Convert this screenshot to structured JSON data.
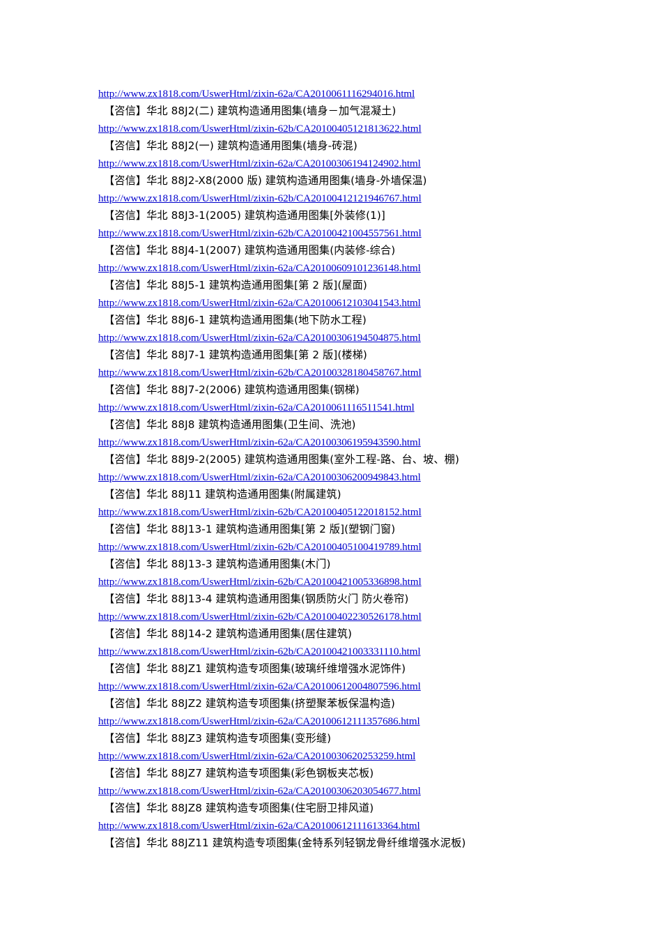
{
  "document": {
    "page_background": "#ffffff",
    "link_color": "#0000cc",
    "text_color": "#000000"
  },
  "entries": [
    {
      "url": "http://www.zx1818.com/UswerHtml/zixin-62a/CA2010061116294016.html",
      "title": "【咨信】华北 88J2(二) 建筑构造通用图集(墙身－加气混凝土)"
    },
    {
      "url": "http://www.zx1818.com/UswerHtml/zixin-62b/CA20100405121813622.html",
      "title": "【咨信】华北 88J2(一) 建筑构造通用图集(墙身-砖混)"
    },
    {
      "url": "http://www.zx1818.com/UswerHtml/zixin-62a/CA20100306194124902.html",
      "title": "【咨信】华北 88J2-X8(2000 版) 建筑构造通用图集(墙身-外墙保温)"
    },
    {
      "url": "http://www.zx1818.com/UswerHtml/zixin-62b/CA20100412121946767.html",
      "title": "【咨信】华北 88J3-1(2005) 建筑构造通用图集[外装修(1)]"
    },
    {
      "url": "http://www.zx1818.com/UswerHtml/zixin-62b/CA20100421004557561.html",
      "title": "【咨信】华北 88J4-1(2007) 建筑构造通用图集(内装修-综合)"
    },
    {
      "url": "http://www.zx1818.com/UswerHtml/zixin-62a/CA20100609101236148.html",
      "title": "【咨信】华北 88J5-1 建筑构造通用图集[第 2 版](屋面)"
    },
    {
      "url": "http://www.zx1818.com/UswerHtml/zixin-62a/CA20100612103041543.html",
      "title": "【咨信】华北 88J6-1 建筑构造通用图集(地下防水工程)"
    },
    {
      "url": "http://www.zx1818.com/UswerHtml/zixin-62a/CA20100306194504875.html",
      "title": "【咨信】华北 88J7-1 建筑构造通用图集[第 2 版](楼梯)"
    },
    {
      "url": "http://www.zx1818.com/UswerHtml/zixin-62b/CA20100328180458767.html",
      "title": "【咨信】华北 88J7-2(2006) 建筑构造通用图集(钢梯)"
    },
    {
      "url": "http://www.zx1818.com/UswerHtml/zixin-62a/CA2010061116511541.html",
      "title": "【咨信】华北 88J8 建筑构造通用图集(卫生间、洗池)"
    },
    {
      "url": "http://www.zx1818.com/UswerHtml/zixin-62a/CA20100306195943590.html",
      "title": "【咨信】华北 88J9-2(2005) 建筑构造通用图集(室外工程-路、台、坡、棚)"
    },
    {
      "url": "http://www.zx1818.com/UswerHtml/zixin-62a/CA20100306200949843.html",
      "title": "【咨信】华北 88J11 建筑构造通用图集(附属建筑)"
    },
    {
      "url": "http://www.zx1818.com/UswerHtml/zixin-62b/CA20100405122018152.html",
      "title": "【咨信】华北 88J13-1 建筑构造通用图集[第 2 版](塑钢门窗)"
    },
    {
      "url": "http://www.zx1818.com/UswerHtml/zixin-62b/CA20100405100419789.html",
      "title": "【咨信】华北 88J13-3 建筑构造通用图集(木门)"
    },
    {
      "url": "http://www.zx1818.com/UswerHtml/zixin-62b/CA20100421005336898.html",
      "title": "【咨信】华北 88J13-4 建筑构造通用图集(钢质防火门 防火卷帘)"
    },
    {
      "url": "http://www.zx1818.com/UswerHtml/zixin-62b/CA20100402230526178.html",
      "title": "【咨信】华北 88J14-2 建筑构造通用图集(居住建筑)"
    },
    {
      "url": "http://www.zx1818.com/UswerHtml/zixin-62b/CA20100421003331110.html",
      "title": "【咨信】华北 88JZ1 建筑构造专项图集(玻璃纤维增强水泥饰件)"
    },
    {
      "url": "http://www.zx1818.com/UswerHtml/zixin-62a/CA20100612004807596.html",
      "title": "【咨信】华北 88JZ2 建筑构造专项图集(挤塑聚苯板保温构造)"
    },
    {
      "url": "http://www.zx1818.com/UswerHtml/zixin-62a/CA20100612111357686.html",
      "title": "【咨信】华北 88JZ3 建筑构造专项图集(变形缝)"
    },
    {
      "url": "http://www.zx1818.com/UswerHtml/zixin-62a/CA2010030620253259.html",
      "title": "【咨信】华北 88JZ7 建筑构造专项图集(彩色钢板夹芯板)"
    },
    {
      "url": "http://www.zx1818.com/UswerHtml/zixin-62a/CA20100306203054677.html",
      "title": "【咨信】华北 88JZ8 建筑构造专项图集(住宅厨卫排风道)"
    },
    {
      "url": "http://www.zx1818.com/UswerHtml/zixin-62a/CA20100612111613364.html",
      "title": "【咨信】华北 88JZ11 建筑构造专项图集(金特系列轻钢龙骨纤维增强水泥板)"
    }
  ]
}
